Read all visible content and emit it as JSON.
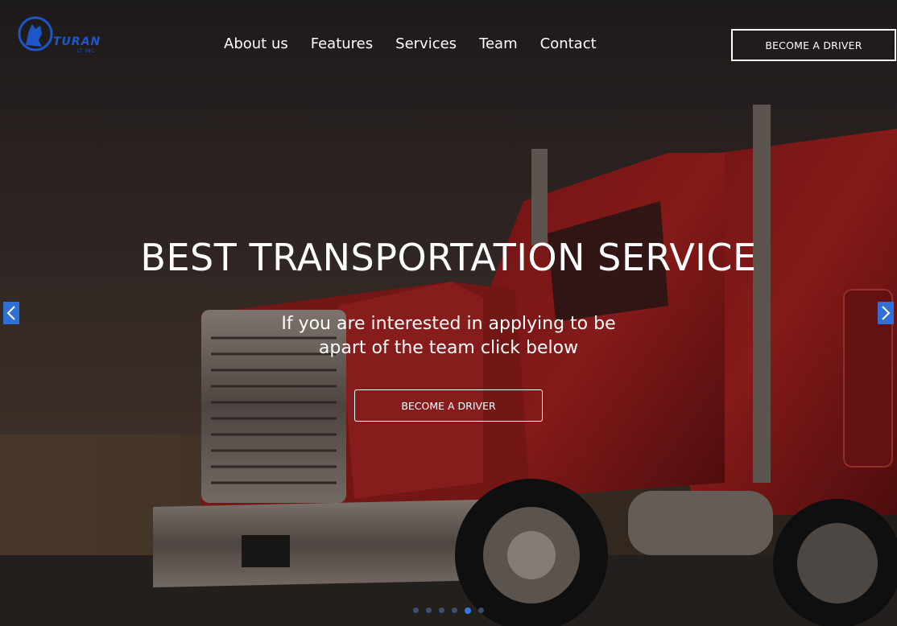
{
  "brand": {
    "logo_text": "TURAN",
    "logo_sub": "LT INC",
    "accent_color": "#1c56c8"
  },
  "nav": {
    "items": [
      {
        "label": "About us"
      },
      {
        "label": "Features"
      },
      {
        "label": "Services"
      },
      {
        "label": "Team"
      },
      {
        "label": "Contact"
      }
    ]
  },
  "header": {
    "cta_label": "BECOME A DRIVER"
  },
  "hero": {
    "title": "BEST TRANSPORTATION SERVICE",
    "subtitle_line1": "If you are interested in applying to be",
    "subtitle_line2": "apart of the team click below",
    "cta_label": "BECOME A DRIVER",
    "background_icon": "red-semi-truck-image"
  },
  "carousel": {
    "prev_icon": "chevron-left-icon",
    "next_icon": "chevron-right-icon",
    "slide_count": 6,
    "active_slide": 5,
    "arrow_color": "#2f6fd6"
  }
}
